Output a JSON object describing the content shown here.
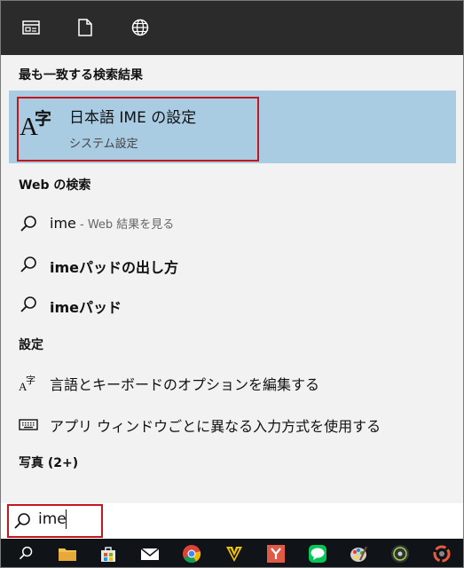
{
  "top_icons": [
    "newsfeed-icon",
    "document-icon",
    "globe-icon"
  ],
  "best_match": {
    "header": "最も一致する検索結果",
    "icon_a": "A",
    "icon_ji": "字",
    "title": "日本語 IME の設定",
    "subtitle": "システム設定"
  },
  "web_search": {
    "header": "Web の検索",
    "items": [
      {
        "main": "ime",
        "hint": " - Web 結果を見る"
      },
      {
        "main": "imeパッドの出し方",
        "hint": ""
      },
      {
        "main": "imeパッド",
        "hint": ""
      }
    ]
  },
  "settings": {
    "header": "設定",
    "items": [
      {
        "icon": "language-icon",
        "label": "言語とキーボードのオプションを編集する"
      },
      {
        "icon": "keyboard-icon",
        "label": "アプリ ウィンドウごとに異なる入力方式を使用する"
      }
    ]
  },
  "photos": {
    "header": "写真 (2+)"
  },
  "search": {
    "value": "ime"
  },
  "colors": {
    "highlight": "#a9cce3",
    "outline": "#c4161c",
    "taskbar": "#101418"
  }
}
